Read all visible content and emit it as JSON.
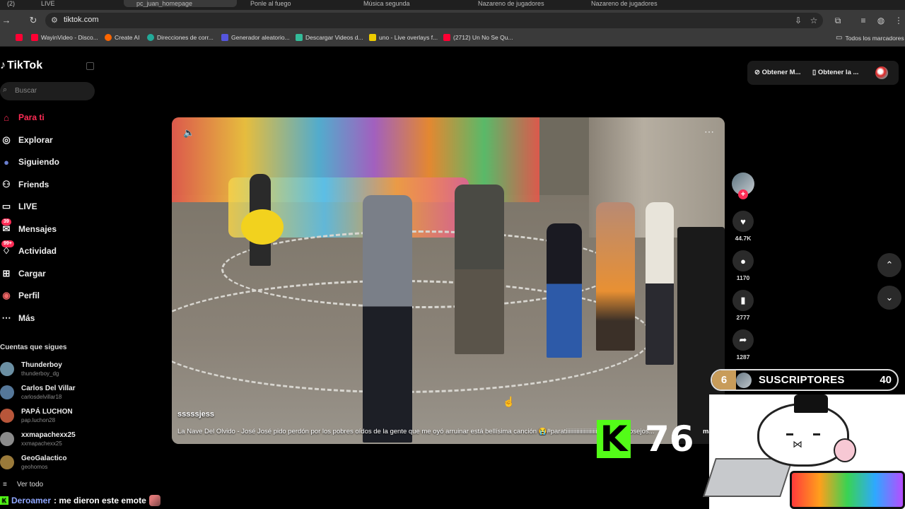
{
  "browser": {
    "tabs": [
      "(2)",
      "LIVE",
      "pc_juan_homepage",
      "Ponle al fuego",
      "Música segunda",
      "Nazareno de jugadores",
      "Nazareno de jugadores"
    ],
    "url": "tiktok.com",
    "bookmarks": [
      {
        "label": "WayinVideo - Disco...",
        "color": "#f03"
      },
      {
        "label": "Create AI",
        "color": "#f60"
      },
      {
        "label": "Direcciones de corr...",
        "color": "#2a9"
      },
      {
        "label": "Generador aleatorio...",
        "color": "#55d"
      },
      {
        "label": "Descargar Videos d...",
        "color": "#3b9"
      },
      {
        "label": "uno - Live overlays f...",
        "color": "#ec0"
      },
      {
        "label": "(2712) Un No Se Qu...",
        "color": "#f03"
      }
    ],
    "all_bookmarks": "Todos los marcadores"
  },
  "sidebar": {
    "logo": "TikTok",
    "search_placeholder": "Buscar",
    "nav": [
      {
        "label": "Para ti",
        "icon": "home-icon",
        "glyph": "⌂",
        "active": true
      },
      {
        "label": "Explorar",
        "icon": "compass-icon",
        "glyph": "◎"
      },
      {
        "label": "Siguiendo",
        "icon": "following-icon",
        "glyph": "●"
      },
      {
        "label": "Friends",
        "icon": "friends-icon",
        "glyph": "⚇"
      },
      {
        "label": "LIVE",
        "icon": "live-icon",
        "glyph": "▭"
      },
      {
        "label": "Mensajes",
        "icon": "messages-icon",
        "glyph": "✉",
        "badge": "39"
      },
      {
        "label": "Actividad",
        "icon": "activity-icon",
        "glyph": "♢",
        "badge": "99+"
      },
      {
        "label": "Cargar",
        "icon": "upload-icon",
        "glyph": "⊞"
      },
      {
        "label": "Perfil",
        "icon": "profile-icon",
        "glyph": "◉"
      },
      {
        "label": "Más",
        "icon": "more-icon",
        "glyph": "⋯"
      }
    ],
    "following_title": "Cuentas que sigues",
    "following": [
      {
        "name": "Thunderboy",
        "handle": "thunderboy_dg",
        "color": "#6b8fa3"
      },
      {
        "name": "Carlos Del Villar",
        "handle": "carlosdelvillar18",
        "color": "#557799"
      },
      {
        "name": "PAPÁ LUCHON",
        "handle": "pap.luchon28",
        "color": "#b8563a"
      },
      {
        "name": "xxmapachexx25",
        "handle": "xxmapachexx25",
        "color": "#8a8a8a"
      },
      {
        "name": "GeoGalactico",
        "handle": "geohomos",
        "color": "#9a7a3a"
      }
    ],
    "see_all": "Ver todo"
  },
  "topright": {
    "get_1": "Obtener M...",
    "get_2": "Obtener la ..."
  },
  "video": {
    "username": "sssssjess",
    "description": "La Nave Del Olvido - José José pido perdón por los pobres oídos de la gente que me oyó arruinar está bellísima canción 😭#paratiiiiiiiiiiiiiiiiiiiiiii #cover #josejos...",
    "more": "más"
  },
  "actions": {
    "likes": "44.7K",
    "comments": "1170",
    "saves": "2777",
    "shares": "1287"
  },
  "overlay": {
    "subs_number": "6",
    "subs_label": "SUSCRIPTORES",
    "subs_count": "40",
    "kick_logo": "K",
    "kick_count": "76",
    "chat_user": "Deroamer",
    "chat_message": ": me dieron este emote"
  }
}
